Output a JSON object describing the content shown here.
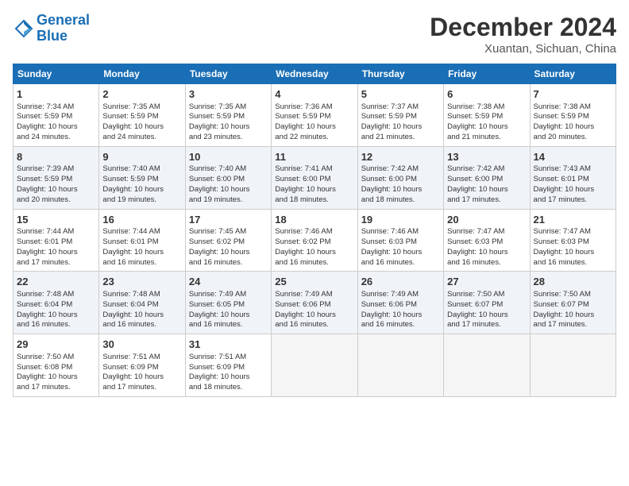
{
  "header": {
    "logo_line1": "General",
    "logo_line2": "Blue",
    "month_title": "December 2024",
    "location": "Xuantan, Sichuan, China"
  },
  "days_of_week": [
    "Sunday",
    "Monday",
    "Tuesday",
    "Wednesday",
    "Thursday",
    "Friday",
    "Saturday"
  ],
  "weeks": [
    [
      {
        "day": "1",
        "lines": [
          "Sunrise: 7:34 AM",
          "Sunset: 5:59 PM",
          "Daylight: 10 hours",
          "and 24 minutes."
        ]
      },
      {
        "day": "2",
        "lines": [
          "Sunrise: 7:35 AM",
          "Sunset: 5:59 PM",
          "Daylight: 10 hours",
          "and 24 minutes."
        ]
      },
      {
        "day": "3",
        "lines": [
          "Sunrise: 7:35 AM",
          "Sunset: 5:59 PM",
          "Daylight: 10 hours",
          "and 23 minutes."
        ]
      },
      {
        "day": "4",
        "lines": [
          "Sunrise: 7:36 AM",
          "Sunset: 5:59 PM",
          "Daylight: 10 hours",
          "and 22 minutes."
        ]
      },
      {
        "day": "5",
        "lines": [
          "Sunrise: 7:37 AM",
          "Sunset: 5:59 PM",
          "Daylight: 10 hours",
          "and 21 minutes."
        ]
      },
      {
        "day": "6",
        "lines": [
          "Sunrise: 7:38 AM",
          "Sunset: 5:59 PM",
          "Daylight: 10 hours",
          "and 21 minutes."
        ]
      },
      {
        "day": "7",
        "lines": [
          "Sunrise: 7:38 AM",
          "Sunset: 5:59 PM",
          "Daylight: 10 hours",
          "and 20 minutes."
        ]
      }
    ],
    [
      {
        "day": "8",
        "lines": [
          "Sunrise: 7:39 AM",
          "Sunset: 5:59 PM",
          "Daylight: 10 hours",
          "and 20 minutes."
        ]
      },
      {
        "day": "9",
        "lines": [
          "Sunrise: 7:40 AM",
          "Sunset: 5:59 PM",
          "Daylight: 10 hours",
          "and 19 minutes."
        ]
      },
      {
        "day": "10",
        "lines": [
          "Sunrise: 7:40 AM",
          "Sunset: 6:00 PM",
          "Daylight: 10 hours",
          "and 19 minutes."
        ]
      },
      {
        "day": "11",
        "lines": [
          "Sunrise: 7:41 AM",
          "Sunset: 6:00 PM",
          "Daylight: 10 hours",
          "and 18 minutes."
        ]
      },
      {
        "day": "12",
        "lines": [
          "Sunrise: 7:42 AM",
          "Sunset: 6:00 PM",
          "Daylight: 10 hours",
          "and 18 minutes."
        ]
      },
      {
        "day": "13",
        "lines": [
          "Sunrise: 7:42 AM",
          "Sunset: 6:00 PM",
          "Daylight: 10 hours",
          "and 17 minutes."
        ]
      },
      {
        "day": "14",
        "lines": [
          "Sunrise: 7:43 AM",
          "Sunset: 6:01 PM",
          "Daylight: 10 hours",
          "and 17 minutes."
        ]
      }
    ],
    [
      {
        "day": "15",
        "lines": [
          "Sunrise: 7:44 AM",
          "Sunset: 6:01 PM",
          "Daylight: 10 hours",
          "and 17 minutes."
        ]
      },
      {
        "day": "16",
        "lines": [
          "Sunrise: 7:44 AM",
          "Sunset: 6:01 PM",
          "Daylight: 10 hours",
          "and 16 minutes."
        ]
      },
      {
        "day": "17",
        "lines": [
          "Sunrise: 7:45 AM",
          "Sunset: 6:02 PM",
          "Daylight: 10 hours",
          "and 16 minutes."
        ]
      },
      {
        "day": "18",
        "lines": [
          "Sunrise: 7:46 AM",
          "Sunset: 6:02 PM",
          "Daylight: 10 hours",
          "and 16 minutes."
        ]
      },
      {
        "day": "19",
        "lines": [
          "Sunrise: 7:46 AM",
          "Sunset: 6:03 PM",
          "Daylight: 10 hours",
          "and 16 minutes."
        ]
      },
      {
        "day": "20",
        "lines": [
          "Sunrise: 7:47 AM",
          "Sunset: 6:03 PM",
          "Daylight: 10 hours",
          "and 16 minutes."
        ]
      },
      {
        "day": "21",
        "lines": [
          "Sunrise: 7:47 AM",
          "Sunset: 6:03 PM",
          "Daylight: 10 hours",
          "and 16 minutes."
        ]
      }
    ],
    [
      {
        "day": "22",
        "lines": [
          "Sunrise: 7:48 AM",
          "Sunset: 6:04 PM",
          "Daylight: 10 hours",
          "and 16 minutes."
        ]
      },
      {
        "day": "23",
        "lines": [
          "Sunrise: 7:48 AM",
          "Sunset: 6:04 PM",
          "Daylight: 10 hours",
          "and 16 minutes."
        ]
      },
      {
        "day": "24",
        "lines": [
          "Sunrise: 7:49 AM",
          "Sunset: 6:05 PM",
          "Daylight: 10 hours",
          "and 16 minutes."
        ]
      },
      {
        "day": "25",
        "lines": [
          "Sunrise: 7:49 AM",
          "Sunset: 6:06 PM",
          "Daylight: 10 hours",
          "and 16 minutes."
        ]
      },
      {
        "day": "26",
        "lines": [
          "Sunrise: 7:49 AM",
          "Sunset: 6:06 PM",
          "Daylight: 10 hours",
          "and 16 minutes."
        ]
      },
      {
        "day": "27",
        "lines": [
          "Sunrise: 7:50 AM",
          "Sunset: 6:07 PM",
          "Daylight: 10 hours",
          "and 17 minutes."
        ]
      },
      {
        "day": "28",
        "lines": [
          "Sunrise: 7:50 AM",
          "Sunset: 6:07 PM",
          "Daylight: 10 hours",
          "and 17 minutes."
        ]
      }
    ],
    [
      {
        "day": "29",
        "lines": [
          "Sunrise: 7:50 AM",
          "Sunset: 6:08 PM",
          "Daylight: 10 hours",
          "and 17 minutes."
        ]
      },
      {
        "day": "30",
        "lines": [
          "Sunrise: 7:51 AM",
          "Sunset: 6:09 PM",
          "Daylight: 10 hours",
          "and 17 minutes."
        ]
      },
      {
        "day": "31",
        "lines": [
          "Sunrise: 7:51 AM",
          "Sunset: 6:09 PM",
          "Daylight: 10 hours",
          "and 18 minutes."
        ]
      },
      {
        "day": "",
        "lines": []
      },
      {
        "day": "",
        "lines": []
      },
      {
        "day": "",
        "lines": []
      },
      {
        "day": "",
        "lines": []
      }
    ]
  ]
}
